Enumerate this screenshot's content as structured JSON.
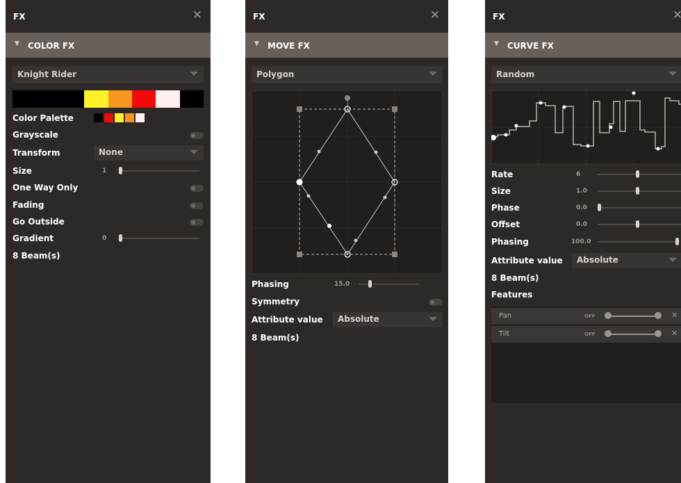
{
  "colors": {
    "panel_bg": "#2c2927",
    "section_bg": "#68605a",
    "dropdown_bg": "#383431",
    "graph_bg": "#211e1c"
  },
  "panels": [
    {
      "title": "FX",
      "close": "✕",
      "section": "COLOR FX",
      "preset": "Knight Rider",
      "strip_colors": [
        "#000000",
        "#000000",
        "#000000",
        "#fff12a",
        "#f7971e",
        "#f20a0a",
        "#fff0f0",
        "#000000"
      ],
      "rows": {
        "color_palette": "Color Palette",
        "grayscale": "Grayscale",
        "transform": "Transform",
        "transform_value": "None",
        "size": "Size",
        "size_value": "1",
        "one_way_only": "One Way Only",
        "fading": "Fading",
        "go_outside": "Go Outside",
        "gradient": "Gradient",
        "gradient_value": "0",
        "beams": "8 Beam(s)"
      },
      "palette": [
        "#000000",
        "#f20a0a",
        "#fff12a",
        "#f7971e",
        "#fff0f0"
      ],
      "toggles": {
        "grayscale": false,
        "one_way_only": false,
        "fading": false,
        "go_outside": false
      },
      "slider_levels": {
        "size": 0.0,
        "gradient": 0.0
      }
    },
    {
      "title": "FX",
      "close": "✕",
      "section": "MOVE FX",
      "preset": "Polygon",
      "rows": {
        "phasing": "Phasing",
        "phasing_value": "15.0",
        "symmetry": "Symmetry",
        "attribute_value": "Attribute value",
        "attribute_value_value": "Absolute",
        "beams": "8 Beam(s)"
      },
      "toggles": {
        "symmetry": false
      },
      "slider_levels": {
        "phasing": 0.15
      }
    },
    {
      "title": "FX",
      "close": "✕",
      "section": "CURVE FX",
      "preset": "Random",
      "rows": {
        "rate": "Rate",
        "rate_value": "6",
        "size": "Size",
        "size_value": "1.0",
        "phase": "Phase",
        "phase_value": "0.0",
        "offset": "Offset",
        "offset_value": "0.0",
        "phasing": "Phasing",
        "phasing_value": "100.0",
        "attribute_value": "Attribute value",
        "attribute_value_value": "Absolute",
        "beams": "8 Beam(s)",
        "features": "Features"
      },
      "slider_levels": {
        "rate": 0.5,
        "size": 0.5,
        "phase": 0.0,
        "offset": 0.5,
        "phasing": 1.0
      },
      "features": [
        {
          "name": "Pan",
          "state": "OFF",
          "remove": "✕"
        },
        {
          "name": "Tilt",
          "state": "OFF",
          "remove": "✕"
        }
      ]
    }
  ]
}
